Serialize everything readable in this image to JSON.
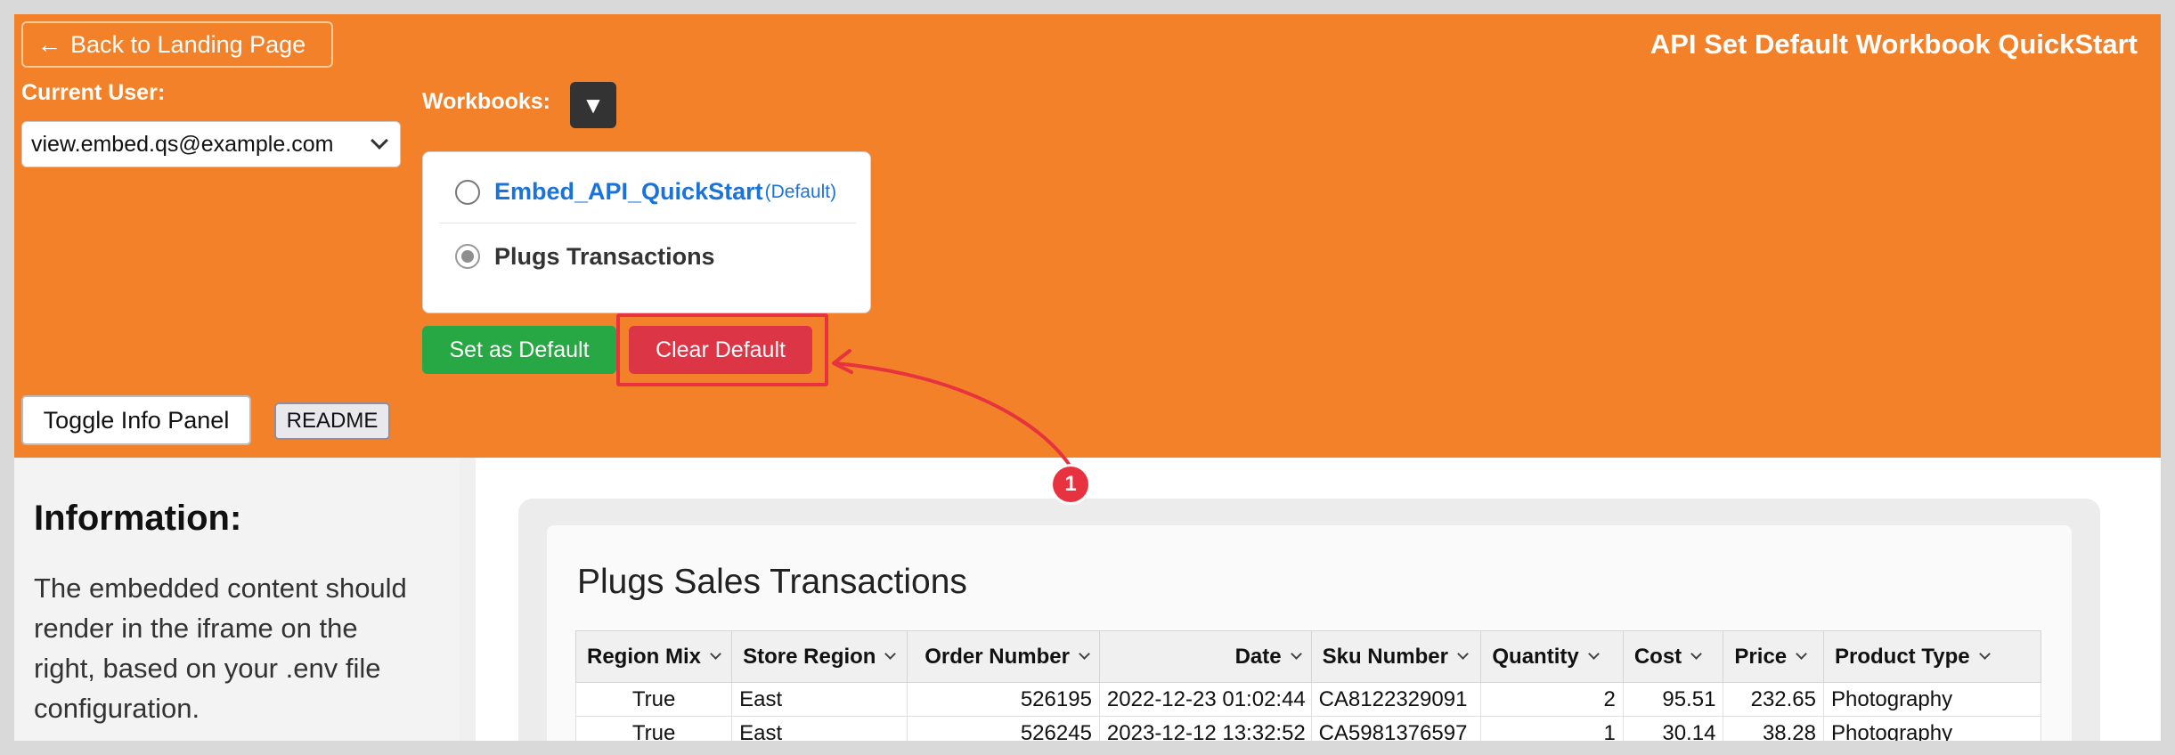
{
  "header": {
    "back_label": "Back to Landing Page",
    "app_title": "API Set Default Workbook QuickStart",
    "current_user_label": "Current User:",
    "current_user_value": "view.embed.qs@example.com",
    "workbooks_label": "Workbooks:",
    "workbooks_toggle_glyph": "▼",
    "workbooks": [
      {
        "name": "Embed_API_QuickStart",
        "tag": "(Default)",
        "selected": false
      },
      {
        "name": "Plugs Transactions",
        "tag": "",
        "selected": true
      }
    ],
    "set_default_label": "Set as Default",
    "clear_default_label": "Clear Default",
    "toggle_info_label": "Toggle Info Panel",
    "readme_label": "README"
  },
  "annotation": {
    "badge": "1",
    "color": "#e7323f"
  },
  "info_panel": {
    "title": "Information:",
    "text": "The embedded content should render in the iframe on the right, based on your .env file configuration."
  },
  "embed": {
    "title": "Plugs Sales Transactions",
    "columns": [
      "Region Mix",
      "Store Region",
      "Order Number",
      "Date",
      "Sku Number",
      "Quantity",
      "Cost",
      "Price",
      "Product Type"
    ],
    "rows": [
      [
        "True",
        "East",
        "526195",
        "2022-12-23 01:02:44",
        "CA8122329091",
        "2",
        "95.51",
        "232.65",
        "Photography"
      ],
      [
        "True",
        "East",
        "526245",
        "2023-12-12 13:32:52",
        "CA5981376597",
        "1",
        "30.14",
        "38.28",
        "Photography"
      ]
    ]
  },
  "colors": {
    "header_bg": "#f28129",
    "success": "#28a745",
    "danger": "#dc3545",
    "link": "#1a73d8"
  },
  "icons": {
    "back": "arrow-left-icon",
    "select": "chevron-down-icon",
    "column_menu": "chevron-down-icon"
  }
}
